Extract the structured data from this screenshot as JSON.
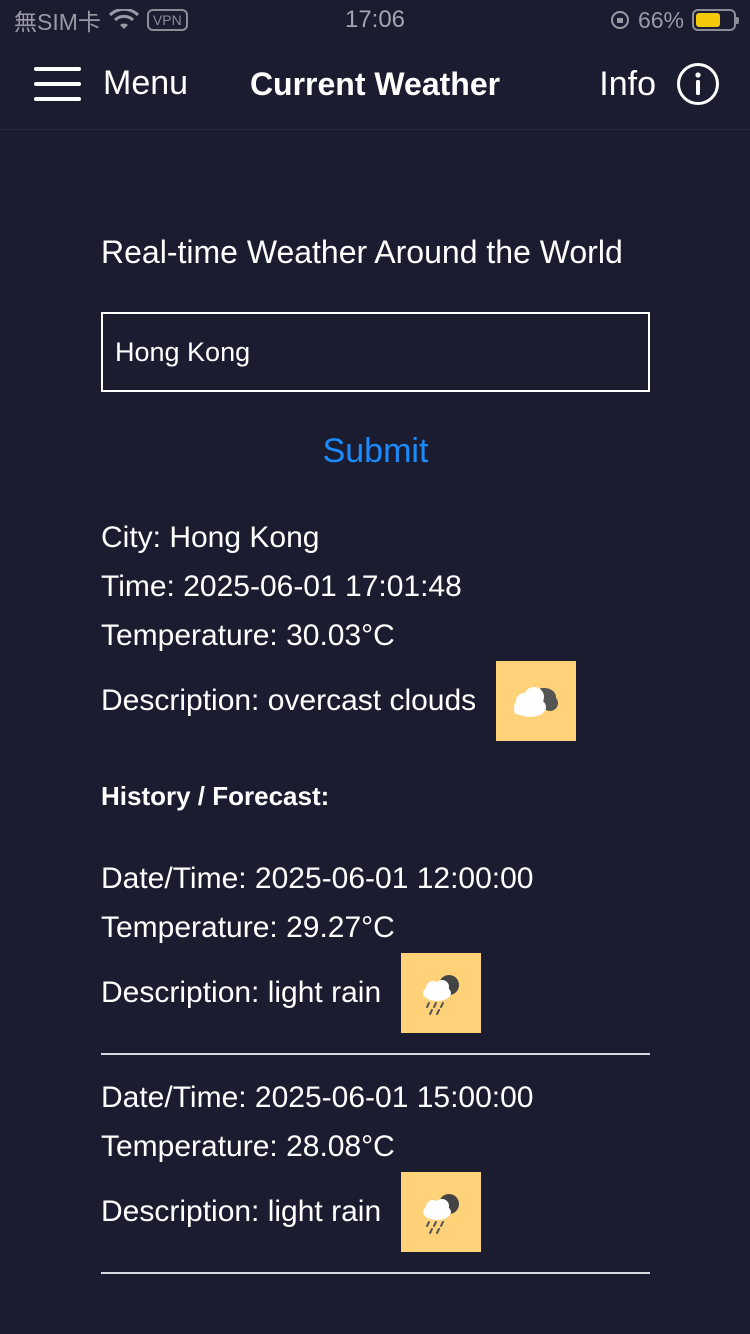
{
  "status_bar": {
    "carrier": "無SIM卡",
    "vpn": "VPN",
    "time": "17:06",
    "battery_percent": "66%",
    "battery_level": 0.66
  },
  "nav": {
    "menu_label": "Menu",
    "title": "Current Weather",
    "info_label": "Info"
  },
  "main": {
    "headline": "Real-time Weather Around the World",
    "city_input_value": "Hong Kong",
    "submit_label": "Submit"
  },
  "current": {
    "city": "City: Hong Kong",
    "time": "Time: 2025-06-01 17:01:48",
    "temperature": "Temperature: 30.03°C",
    "description": "Description: overcast clouds",
    "icon": "overcast-clouds-icon"
  },
  "history_title": "History / Forecast:",
  "forecast": [
    {
      "datetime": "Date/Time: 2025-06-01 12:00:00",
      "temperature": "Temperature: 29.27°C",
      "description": "Description: light rain",
      "icon": "light-rain-icon"
    },
    {
      "datetime": "Date/Time: 2025-06-01 15:00:00",
      "temperature": "Temperature: 28.08°C",
      "description": "Description: light rain",
      "icon": "light-rain-icon"
    }
  ],
  "colors": {
    "background": "#1b1c30",
    "accent": "#1a8cff",
    "icon_bg": "#ffd27a"
  }
}
